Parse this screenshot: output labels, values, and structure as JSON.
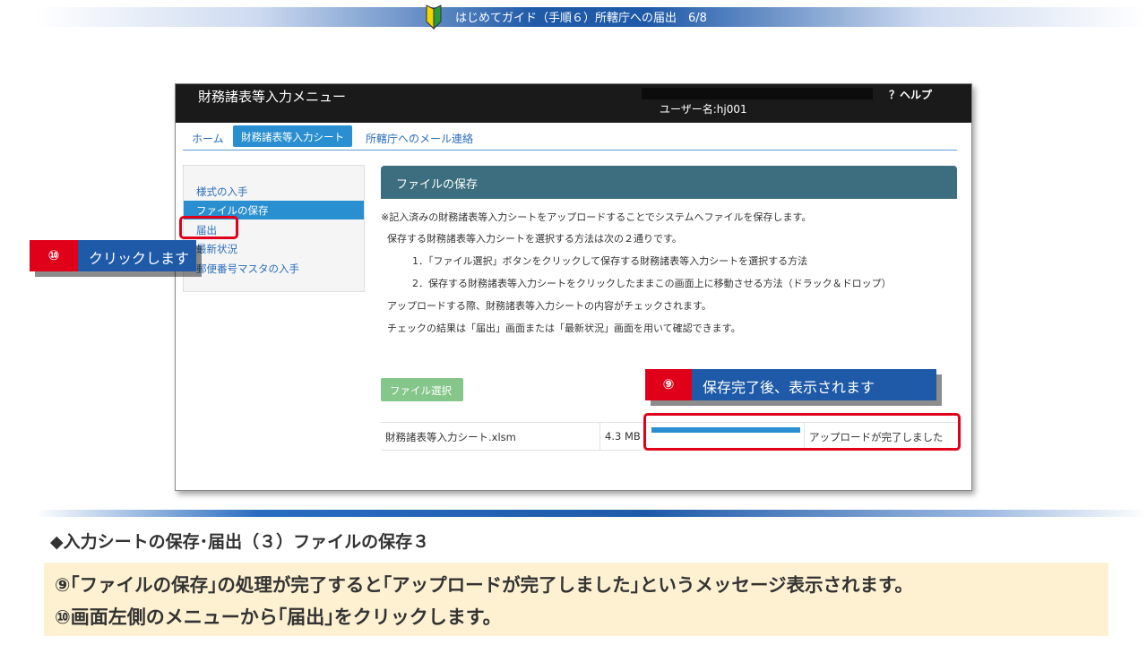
{
  "banner": {
    "title": "はじめてガイド（手順６）所轄庁への届出　6/8",
    "mark_icon": "beginner-mark-icon"
  },
  "app": {
    "title": "財務諸表等入力メニュー",
    "user_name": "ユーザー名:hj001",
    "help": "？ヘルプ",
    "nav": {
      "home": "ホーム",
      "sheet": "財務諸表等入力シート",
      "mail": "所轄庁へのメール連絡"
    },
    "side_menu": [
      "様式の入手",
      "ファイルの保存",
      "届出",
      "最新状況",
      "郵便番号マスタの入手"
    ],
    "panel_title": "ファイルの保存",
    "descriptions": [
      "※記入済みの財務諸表等入力シートをアップロードすることでシステムへファイルを保存します。",
      "保存する財務諸表等入力シートを選択する方法は次の２通りです。",
      "1．「ファイル選択」ボタンをクリックして保存する財務諸表等入力シートを選択する方法",
      "2．保存する財務諸表等入力シートをクリックしたままこの画面上に移動させる方法（ドラック＆ドロップ）",
      "アップロードする際、財務諸表等入力シートの内容がチェックされます。",
      "チェックの結果は「届出」画面または「最新状況」画面を用いて確認できます。"
    ],
    "file_button": "ファイル選択",
    "upload": {
      "file_name": "財務諸表等入力シート.xlsm",
      "size": "4.3 MB",
      "progress": 1.0,
      "status": "アップロードが完了しました"
    }
  },
  "callouts": {
    "step9": {
      "num": "⑨",
      "text": "保存完了後、表示されます"
    },
    "step10": {
      "num": "⑩",
      "text": "クリックします"
    }
  },
  "section_heading": "◆入力シートの保存･届出（３）ファイルの保存３",
  "notes": [
    "⑨｢ファイルの保存｣の処理が完了すると｢アップロードが完了しました｣というメッセージ表示されます。",
    "⑩画面左側のメニューから｢届出｣をクリックします。"
  ],
  "colors": {
    "accent_blue": "#1e5aa8",
    "callout_red": "#e0001a",
    "panel_head": "#3c6e7f",
    "note_bg": "#fdf1d2"
  }
}
